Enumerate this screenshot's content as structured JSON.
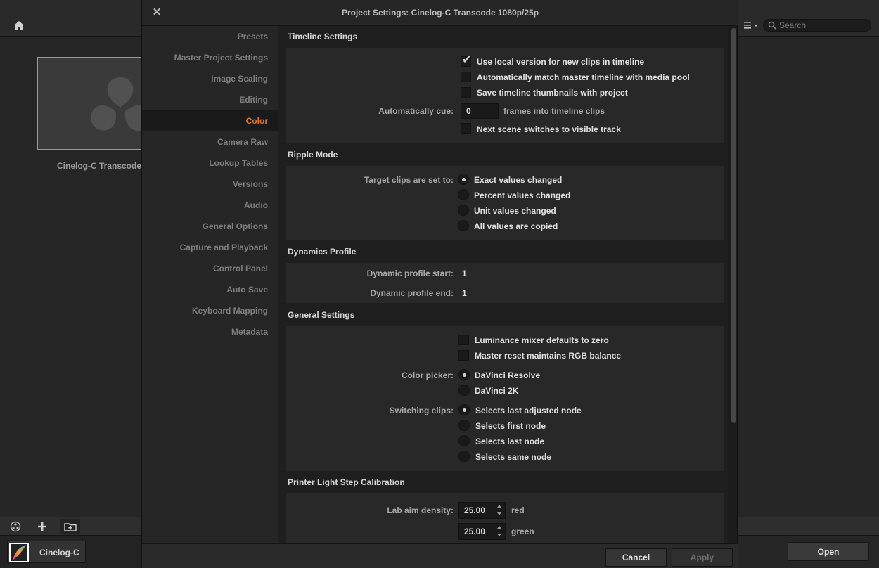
{
  "background": {
    "project_name": "Cinelog-C Transcode",
    "user_name": "Cinelog-C",
    "search_placeholder": "Search",
    "open_label": "Open"
  },
  "dialog": {
    "title": "Project Settings:  Cinelog-C Transcode 1080p/25p",
    "nav": [
      {
        "label": "Presets",
        "active": false
      },
      {
        "label": "Master Project Settings",
        "active": false
      },
      {
        "label": "Image Scaling",
        "active": false
      },
      {
        "label": "Editing",
        "active": false
      },
      {
        "label": "Color",
        "active": true
      },
      {
        "label": "Camera Raw",
        "active": false
      },
      {
        "label": "Lookup Tables",
        "active": false
      },
      {
        "label": "Versions",
        "active": false
      },
      {
        "label": "Audio",
        "active": false
      },
      {
        "label": "General Options",
        "active": false
      },
      {
        "label": "Capture and Playback",
        "active": false
      },
      {
        "label": "Control Panel",
        "active": false
      },
      {
        "label": "Auto Save",
        "active": false
      },
      {
        "label": "Keyboard Mapping",
        "active": false
      },
      {
        "label": "Metadata",
        "active": false
      }
    ],
    "cancel_label": "Cancel",
    "apply_label": "Apply"
  },
  "timeline_settings": {
    "title": "Timeline Settings",
    "use_local_version": {
      "label": "Use local version for new clips in timeline",
      "checked": true
    },
    "auto_match_master": {
      "label": "Automatically match master timeline with media pool",
      "checked": false
    },
    "save_thumbnails": {
      "label": "Save timeline thumbnails with project",
      "checked": false
    },
    "auto_cue_label": "Automatically cue:",
    "auto_cue_value": "0",
    "auto_cue_suffix": "frames into timeline clips",
    "next_scene": {
      "label": "Next scene switches to visible track",
      "checked": false
    }
  },
  "ripple_mode": {
    "title": "Ripple Mode",
    "target_label": "Target clips are set to:",
    "options": [
      {
        "label": "Exact values changed",
        "selected": true
      },
      {
        "label": "Percent values changed",
        "selected": false
      },
      {
        "label": "Unit values changed",
        "selected": false
      },
      {
        "label": "All values are copied",
        "selected": false
      }
    ]
  },
  "dynamics_profile": {
    "title": "Dynamics Profile",
    "start_label": "Dynamic profile start:",
    "start_value": "1",
    "end_label": "Dynamic profile end:",
    "end_value": "1"
  },
  "general_settings": {
    "title": "General Settings",
    "luminance_mixer": {
      "label": "Luminance mixer defaults to zero",
      "checked": false
    },
    "master_reset": {
      "label": "Master reset maintains RGB balance",
      "checked": false
    },
    "color_picker_label": "Color picker:",
    "color_picker_options": [
      {
        "label": "DaVinci Resolve",
        "selected": true
      },
      {
        "label": "DaVinci 2K",
        "selected": false
      }
    ],
    "switching_clips_label": "Switching clips:",
    "switching_clips_options": [
      {
        "label": "Selects last adjusted node",
        "selected": true
      },
      {
        "label": "Selects first node",
        "selected": false
      },
      {
        "label": "Selects last node",
        "selected": false
      },
      {
        "label": "Selects same node",
        "selected": false
      }
    ]
  },
  "printer_light": {
    "title": "Printer Light Step Calibration",
    "lab_aim_label": "Lab aim density:",
    "red_value": "25.00",
    "red_label": "red",
    "green_value": "25.00",
    "green_label": "green"
  }
}
